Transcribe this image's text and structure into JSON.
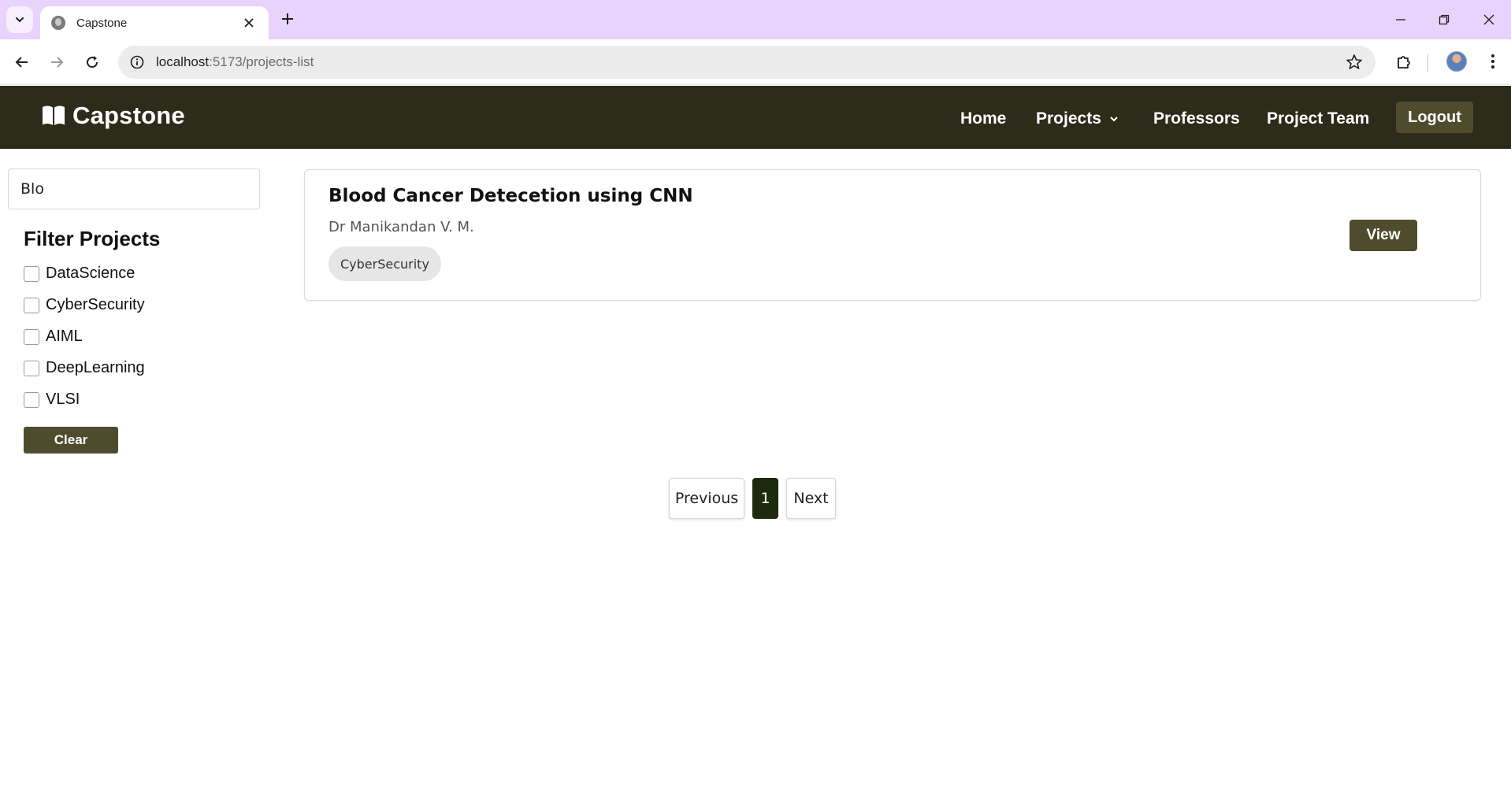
{
  "browser": {
    "tab_title": "Capstone",
    "url_host": "localhost",
    "url_path": ":5173/projects-list"
  },
  "navbar": {
    "brand": "Capstone",
    "links": {
      "home": "Home",
      "projects": "Projects",
      "professors": "Professors",
      "project_team": "Project Team"
    },
    "logout": "Logout"
  },
  "sidebar": {
    "search_value": "Blo",
    "filter_title": "Filter Projects",
    "filters": [
      {
        "label": "DataScience",
        "checked": false
      },
      {
        "label": "CyberSecurity",
        "checked": false
      },
      {
        "label": "AIML",
        "checked": false
      },
      {
        "label": "DeepLearning",
        "checked": false
      },
      {
        "label": "VLSI",
        "checked": false
      }
    ],
    "clear_label": "Clear"
  },
  "projects": [
    {
      "title": "Blood Cancer Detecetion using CNN",
      "professor": "Dr Manikandan V. M.",
      "tag": "CyberSecurity",
      "view_label": "View"
    }
  ],
  "pagination": {
    "previous": "Previous",
    "current": "1",
    "next": "Next"
  },
  "colors": {
    "navbar_bg": "#2d2c1b",
    "accent_button": "#4e4c2c",
    "active_page": "#1d2b0c",
    "tabstrip_bg": "#e7d3fb"
  }
}
